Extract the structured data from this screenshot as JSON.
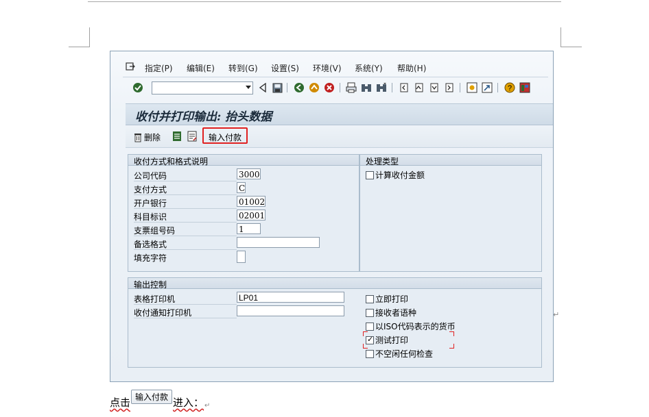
{
  "menu": {
    "items": [
      "指定(P)",
      "编辑(E)",
      "转到(G)",
      "设置(S)",
      "环境(V)",
      "系统(Y)",
      "帮助(H)"
    ]
  },
  "toolbar": {
    "command_value": "",
    "icons": [
      "enter-check-icon",
      "back-icon",
      "save-icon",
      "nav-back-icon",
      "nav-exit-icon",
      "nav-cancel-icon",
      "print-icon",
      "find-icon",
      "find-next-icon",
      "first-page-icon",
      "prev-page-icon",
      "next-page-icon",
      "last-page-icon",
      "new-session-icon",
      "shortcut-icon",
      "help-icon",
      "layout-icon"
    ]
  },
  "page": {
    "title": "收付并打印输出: 抬头数据"
  },
  "app_toolbar": {
    "delete_label": "删除",
    "enter_payments_label": "输入付款"
  },
  "payment_section": {
    "header": "收付方式和格式说明",
    "rows": [
      {
        "label": "公司代码",
        "value": "3000"
      },
      {
        "label": "支付方式",
        "value": "C"
      },
      {
        "label": "开户银行",
        "value": "01002"
      },
      {
        "label": "科目标识",
        "value": "02001"
      },
      {
        "label": "支票组号码",
        "value": "1"
      },
      {
        "label": "备选格式",
        "value": ""
      },
      {
        "label": "填充字符",
        "value": ""
      }
    ]
  },
  "processing_section": {
    "header": "处理类型",
    "calc_amount_label": "计算收付金额",
    "calc_amount_checked": false
  },
  "output_section": {
    "header": "输出控制",
    "form_printer_label": "表格打印机",
    "form_printer_value": "LP01",
    "advice_printer_label": "收付通知打印机",
    "advice_printer_value": "",
    "checks": [
      {
        "label": "立即打印",
        "checked": false
      },
      {
        "label": "接收者语种",
        "checked": false
      },
      {
        "label": "以ISO代码表示的货币",
        "checked": false
      },
      {
        "label": "测试打印",
        "checked": true
      },
      {
        "label": "不空闲任何检查",
        "checked": false
      }
    ]
  },
  "caption": {
    "prefix": "点击",
    "button": "输入付款",
    "suffix": "进入：",
    "para_mark": "↵"
  }
}
